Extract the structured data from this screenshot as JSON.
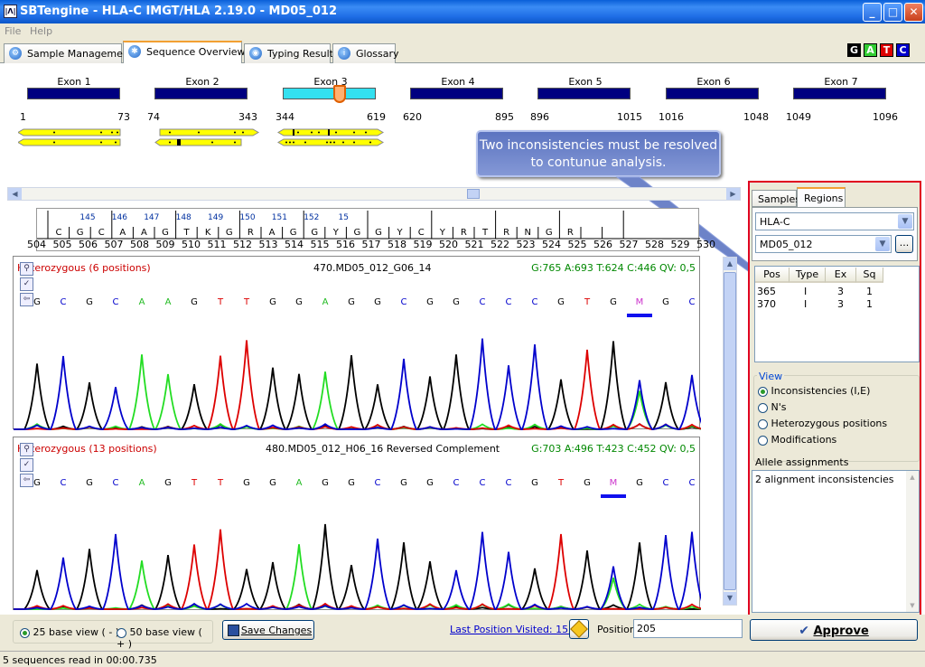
{
  "window": {
    "title": "SBTengine - HLA-C IMGT/HLA 2.19.0 - MD05_012",
    "controls": {
      "minimize": "_",
      "maximize": "□",
      "close": "✕"
    }
  },
  "menu": [
    "File",
    "Help"
  ],
  "tabs": [
    {
      "label": "Sample Management",
      "icon": "gear-icon"
    },
    {
      "label": "Sequence Overview",
      "icon": "sequence-icon",
      "active": true
    },
    {
      "label": "Typing Result",
      "icon": "result-icon"
    },
    {
      "label": "Glossary",
      "icon": "info-icon"
    }
  ],
  "bases": [
    {
      "label": "G",
      "color": "#000000"
    },
    {
      "label": "A",
      "color": "#33cc33"
    },
    {
      "label": "T",
      "color": "#dd0000"
    },
    {
      "label": "C",
      "color": "#0000cc"
    }
  ],
  "exons": [
    {
      "label": "Exon 1",
      "start": "1",
      "end": "73"
    },
    {
      "label": "Exon 2",
      "start": "74",
      "end": "343"
    },
    {
      "label": "Exon 3",
      "start": "344",
      "end": "619"
    },
    {
      "label": "Exon 4",
      "start": "620",
      "end": "895"
    },
    {
      "label": "Exon 5",
      "start": "896",
      "end": "1015"
    },
    {
      "label": "Exon 6",
      "start": "1016",
      "end": "1048"
    },
    {
      "label": "Exon 7",
      "start": "1049",
      "end": "1096"
    }
  ],
  "callout": "Two inconsistencies must be resolved to contunue analysis.",
  "ref": {
    "codons": [
      "145",
      "146",
      "147",
      "148",
      "149",
      "150",
      "151",
      "152",
      "15"
    ],
    "letters": [
      "C",
      "G",
      "C",
      "A",
      "A",
      "G",
      "T",
      "K",
      "G",
      "R",
      "A",
      "G",
      "G",
      "Y",
      "G",
      "G",
      "Y",
      "C",
      "Y",
      "R",
      "T",
      "R",
      "N",
      "G",
      "R"
    ],
    "positions": [
      "504",
      "505",
      "506",
      "507",
      "508",
      "509",
      "510",
      "511",
      "512",
      "513",
      "514",
      "515",
      "516",
      "517",
      "518",
      "519",
      "520",
      "521",
      "522",
      "523",
      "524",
      "525",
      "526",
      "527",
      "528",
      "529",
      "530"
    ]
  },
  "traces": [
    {
      "label": "Heterozygous (6 positions)",
      "name": "470.MD05_012_G06_14",
      "stats": "G:765 A:693 T:624 C:446 QV: 0,5",
      "letters": [
        "G",
        "C",
        "G",
        "C",
        "A",
        "A",
        "G",
        "T",
        "T",
        "G",
        "G",
        "A",
        "G",
        "G",
        "C",
        "G",
        "G",
        "C",
        "C",
        "C",
        "G",
        "T",
        "G",
        "M",
        "G",
        "C"
      ]
    },
    {
      "label": "Heterozygous (13 positions)",
      "name": "480.MD05_012_H06_16 Reversed Complement",
      "stats": "G:703 A:496 T:423 C:452 QV: 0,5",
      "letters": [
        "G",
        "C",
        "G",
        "C",
        "A",
        "G",
        "T",
        "T",
        "G",
        "G",
        "A",
        "G",
        "G",
        "C",
        "G",
        "G",
        "C",
        "C",
        "C",
        "G",
        "T",
        "G",
        "M",
        "G",
        "C",
        "C"
      ]
    }
  ],
  "right": {
    "tabs": [
      "Samples",
      "Regions"
    ],
    "locus": "HLA-C",
    "sample": "MD05_012",
    "browse": "...",
    "table": {
      "headers": [
        "Pos",
        "Type",
        "Ex",
        "Sq"
      ],
      "rows": [
        [
          "365",
          "I",
          "3",
          "1"
        ],
        [
          "370",
          "I",
          "3",
          "1"
        ]
      ]
    },
    "view": {
      "title": "View",
      "options": [
        {
          "label": "Inconsistencies (I,E)",
          "selected": true
        },
        {
          "label": "N's",
          "selected": false
        },
        {
          "label": "Heterozygous positions",
          "selected": false
        },
        {
          "label": "Modifications",
          "selected": false
        }
      ]
    },
    "allele": {
      "title": "Allele assignments",
      "text": "2 alignment inconsistencies"
    }
  },
  "bottom": {
    "view25": "25 base view ( - )",
    "view50": "50 base view ( + )",
    "save": "Save Changes",
    "last": "Last Position Visited: 152",
    "position_label": "Position",
    "position_value": "205",
    "approve": "Approve"
  },
  "status": "5 sequences read in 00:00.735"
}
